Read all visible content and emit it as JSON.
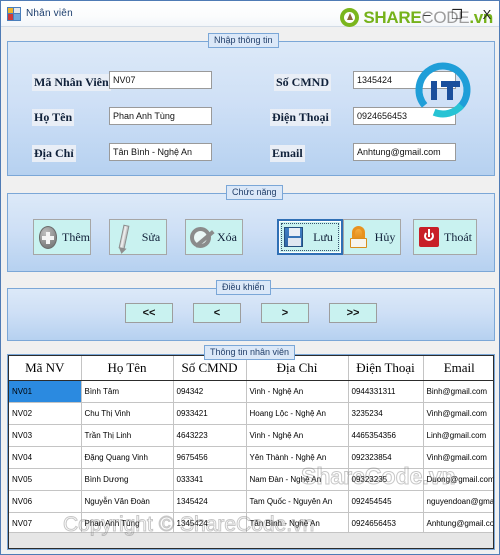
{
  "window": {
    "title": "Nhân viên",
    "icon": "app-icon",
    "controls": {
      "minimize": "–",
      "maximize": "❐",
      "close": "X"
    }
  },
  "brand": {
    "share": "SHARE",
    "code": "CODE",
    "vn": ".vn"
  },
  "watermarks": {
    "sharecode": "ShareCode.vn",
    "copyright": "Copyright © ShareCode.vn"
  },
  "groups": {
    "input": "Nhập thông tin",
    "functions": "Chức năng",
    "navigation": "Điều khiển",
    "table": "Thông tin nhân viên"
  },
  "form": {
    "fields": [
      {
        "label": "Mã Nhân Viên",
        "value": "NV07"
      },
      {
        "label": "Họ Tên",
        "value": "Phan Anh Tùng"
      },
      {
        "label": "Địa Chỉ",
        "value": "Tân Bình - Nghệ An"
      },
      {
        "label": "Số CMND",
        "value": "1345424"
      },
      {
        "label": "Điện Thoại",
        "value": "0924656453"
      },
      {
        "label": "Email",
        "value": "Anhtung@gmail.com"
      }
    ]
  },
  "functions": {
    "buttons": [
      {
        "label": "Thêm",
        "icon": "add-icon"
      },
      {
        "label": "Sửa",
        "icon": "edit-icon"
      },
      {
        "label": "Xóa",
        "icon": "delete-icon"
      },
      {
        "label": "Lưu",
        "icon": "save-icon"
      },
      {
        "label": "Hủy",
        "icon": "cancel-icon"
      },
      {
        "label": "Thoát",
        "icon": "exit-icon"
      }
    ]
  },
  "navigation": {
    "buttons": [
      {
        "label": "<<",
        "icon": "first-record-icon"
      },
      {
        "label": "<",
        "icon": "previous-record-icon"
      },
      {
        "label": ">",
        "icon": "next-record-icon"
      },
      {
        "label": ">>",
        "icon": "last-record-icon"
      }
    ]
  },
  "grid": {
    "columns": [
      "Mã NV",
      "Họ Tên",
      "Số CMND",
      "Địa Chỉ",
      "Điện Thoại",
      "Email"
    ],
    "selected_row": 0,
    "rows": [
      [
        "NV01",
        "Bình Tâm",
        "094342",
        "Vinh - Nghệ An",
        "0944331311",
        "Binh@gmail.com"
      ],
      [
        "NV02",
        "Chu Thị Vinh",
        "0933421",
        "Hoang Lộc - Nghệ An",
        "3235234",
        "Vinh@gmail.com"
      ],
      [
        "NV03",
        "Trần Thị Linh",
        "4643223",
        "Vinh - Nghệ An",
        "4465354356",
        "Linh@gmail.com"
      ],
      [
        "NV04",
        "Đặng Quang Vinh",
        "9675456",
        "Yên Thành - Nghệ An",
        "092323854",
        "Vinh@gmail.com"
      ],
      [
        "NV05",
        "Bình Dương",
        "033341",
        "Nam Đàn - Nghệ An",
        "09323235",
        "Duong@gmail.com"
      ],
      [
        "NV06",
        "Nguyễn Văn Đoàn",
        "1345424",
        "Tam Quốc - Nguyên An",
        "092454545",
        "nguyendoan@gmail.com"
      ],
      [
        "NV07",
        "Phan Anh Tùng",
        "1345424",
        "Tân Bình - Nghệ An",
        "0924656453",
        "Anhtung@gmail.com"
      ]
    ]
  },
  "colors": {
    "panel": "#cfe0f6",
    "panel_border": "#7ba7d7",
    "button_face": "#c9f2f0",
    "selection": "#2b8ae0",
    "brand_green": "#76b21b",
    "brand_gray": "#9d9d9d"
  }
}
